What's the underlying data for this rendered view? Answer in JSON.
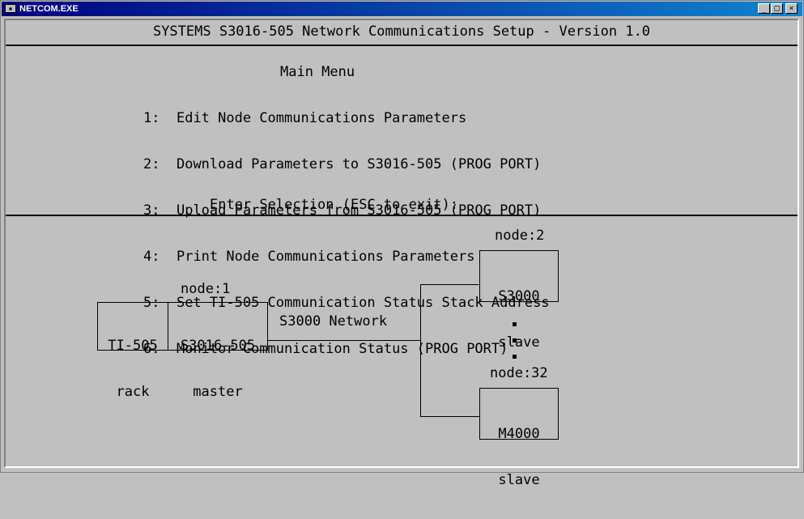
{
  "window": {
    "title": "NETCOM.EXE",
    "icon": "msdos-icon",
    "buttons": {
      "minimize": "_",
      "maximize": "□",
      "close": "×"
    }
  },
  "header": {
    "title": "SYSTEMS S3016-505 Network Communications Setup - Version 1.0"
  },
  "menu": {
    "title": "Main Menu",
    "items": [
      {
        "num": "1:",
        "label": "Edit Node Communications Parameters"
      },
      {
        "num": "2:",
        "label": "Download Parameters to S3016-505 (PROG PORT)"
      },
      {
        "num": "3:",
        "label": "Upload Parameters from S3016-505 (PROG PORT)"
      },
      {
        "num": "4:",
        "label": "Print Node Communications Parameters"
      },
      {
        "num": "5:",
        "label": "Set TI-505 Communication Status Stack Address"
      },
      {
        "num": "6:",
        "label": "Monitor Communication Status (PROG PORT)"
      }
    ],
    "prompt": "Enter Selection (ESC to exit):"
  },
  "diagram": {
    "rack": {
      "line1": "TI-505",
      "line2": "rack"
    },
    "master": {
      "node_label": "node:1",
      "line1": "S3016-505",
      "line2": "master"
    },
    "network_label": "S3000 Network",
    "slave_top": {
      "node_label": "node:2",
      "line1": "S3000",
      "line2": "slave"
    },
    "slave_bottom": {
      "node_label": "node:32",
      "line1": "M4000",
      "line2": "slave"
    }
  }
}
